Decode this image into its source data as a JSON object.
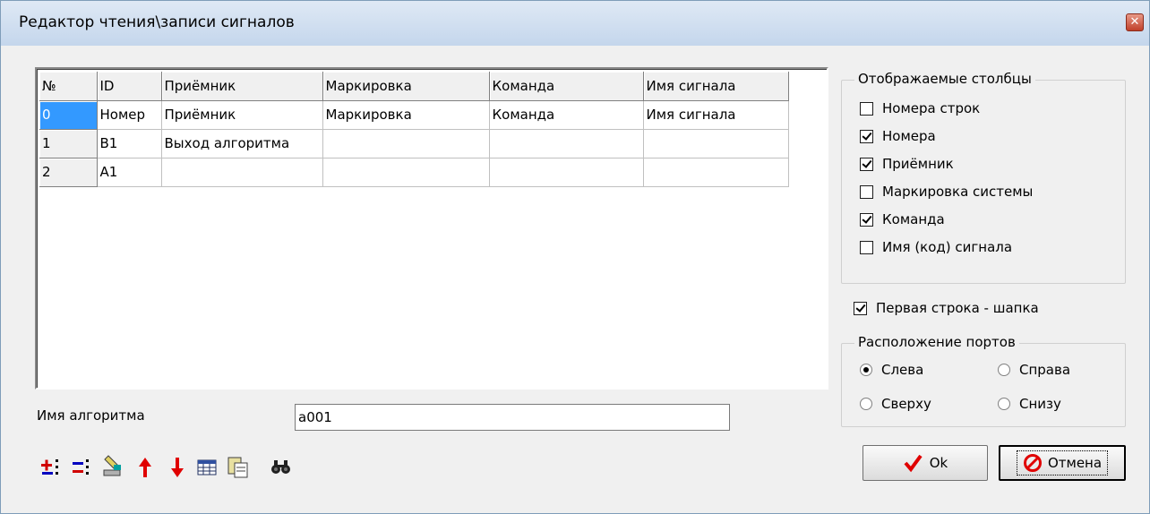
{
  "window": {
    "title": "Редактор чтения\\записи сигналов"
  },
  "grid": {
    "headers": [
      "№",
      "ID",
      "Приёмник",
      "Маркировка",
      "Команда",
      "Имя сигнала"
    ],
    "rows": [
      [
        "0",
        "Номер",
        "Приёмник",
        "Маркировка",
        "Команда",
        "Имя сигнала"
      ],
      [
        "1",
        "B1",
        "Выход алгоритма",
        "",
        "",
        ""
      ],
      [
        "2",
        "A1",
        "",
        "",
        "",
        ""
      ]
    ]
  },
  "algorithm": {
    "label": "Имя алгоритма",
    "value": "a001"
  },
  "toolbar": {
    "icons": [
      "add-row-icon",
      "delete-row-icon",
      "edit-icon",
      "move-up-icon",
      "move-down-icon",
      "table-icon",
      "paste-icon",
      "find-icon"
    ]
  },
  "columns_group": {
    "title": "Отображаемые столбцы",
    "items": [
      {
        "label": "Номера строк",
        "checked": false
      },
      {
        "label": "Номера",
        "checked": true
      },
      {
        "label": "Приёмник",
        "checked": true
      },
      {
        "label": "Маркировка системы",
        "checked": false
      },
      {
        "label": "Команда",
        "checked": true
      },
      {
        "label": "Имя (код) сигнала",
        "checked": false
      }
    ]
  },
  "header_row": {
    "label": "Первая строка - шапка",
    "checked": true
  },
  "ports_group": {
    "title": "Расположение портов",
    "options": [
      {
        "label": "Слева",
        "checked": true
      },
      {
        "label": "Справа",
        "checked": false
      },
      {
        "label": "Сверху",
        "checked": false
      },
      {
        "label": "Снизу",
        "checked": false
      }
    ]
  },
  "buttons": {
    "ok": "Ok",
    "cancel": "Отмена"
  },
  "colors": {
    "selection": "#3399ff",
    "ok_check": "#e00000",
    "cancel_icon": "#e00000"
  }
}
